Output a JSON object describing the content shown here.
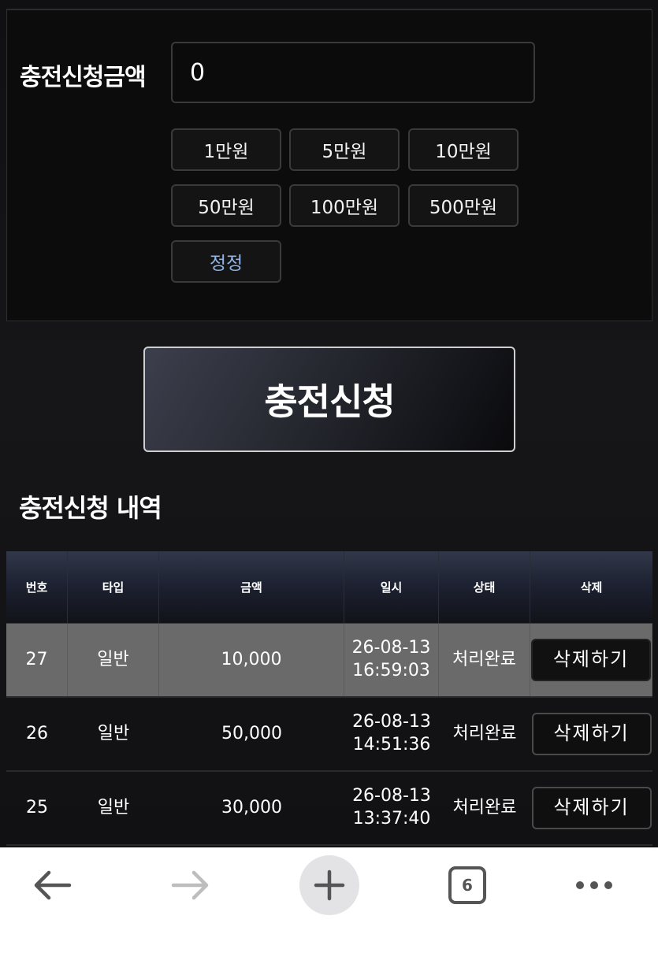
{
  "form": {
    "amount_label": "충전신청금액",
    "amount_value": "0",
    "quick_amounts": [
      "1만원",
      "5만원",
      "10만원",
      "50만원",
      "100만원",
      "500만원"
    ],
    "reset_label": "정정",
    "submit_label": "충전신청"
  },
  "history": {
    "title": "충전신청 내역",
    "columns": [
      "번호",
      "타입",
      "금액",
      "일시",
      "상태",
      "삭제"
    ],
    "rows": [
      {
        "no": "27",
        "type": "일반",
        "amount": "10,000",
        "date": "26-08-13",
        "time": "16:59:03",
        "status": "처리완료",
        "action": "삭제하기"
      },
      {
        "no": "26",
        "type": "일반",
        "amount": "50,000",
        "date": "26-08-13",
        "time": "14:51:36",
        "status": "처리완료",
        "action": "삭제하기"
      },
      {
        "no": "25",
        "type": "일반",
        "amount": "30,000",
        "date": "26-08-13",
        "time": "13:37:40",
        "status": "처리완료",
        "action": "삭제하기"
      }
    ]
  },
  "browser_nav": {
    "back_icon": "arrow-left-icon",
    "forward_icon": "arrow-right-icon",
    "new_tab_icon": "plus-icon",
    "tab_count": "6",
    "menu_icon": "more-horizontal-icon"
  },
  "colors": {
    "background": "#0e0e10",
    "highlight_row": "#6a6a6a",
    "reset_text": "#8fb4e8",
    "header_gradient_top": "#31384a"
  }
}
